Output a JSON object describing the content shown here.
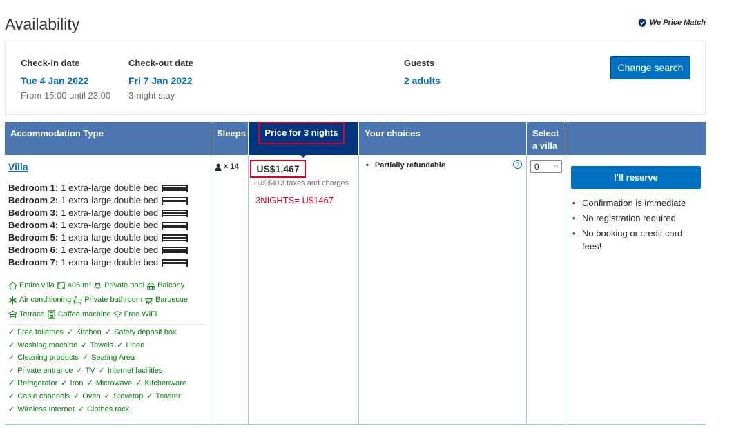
{
  "header": {
    "title": "Availability",
    "price_match": "We Price Match"
  },
  "search": {
    "checkin_label": "Check-in date",
    "checkin_value": "Tue 4 Jan 2022",
    "checkin_sub": "From 15:00 until 23:00",
    "checkout_label": "Check-out date",
    "checkout_value": "Fri 7 Jan 2022",
    "checkout_sub": "3-night stay",
    "guests_label": "Guests",
    "guests_value": "2 adults",
    "change_label": "Change search"
  },
  "table": {
    "headers": {
      "accommodation": "Accommodation Type",
      "sleeps": "Sleeps",
      "price": "Price for 3 nights",
      "choices": "Your choices",
      "select_line1": "Select",
      "select_line2": "a villa"
    },
    "row": {
      "name": "Villa",
      "bedrooms": [
        {
          "label": "Bedroom 1:",
          "bed": "1 extra-large double bed"
        },
        {
          "label": "Bedroom 2:",
          "bed": "1 extra-large double bed"
        },
        {
          "label": "Bedroom 3:",
          "bed": "1 extra-large double bed"
        },
        {
          "label": "Bedroom 4:",
          "bed": "1 extra-large double bed"
        },
        {
          "label": "Bedroom 5:",
          "bed": "1 extra-large double bed"
        },
        {
          "label": "Bedroom 6:",
          "bed": "1 extra-large double bed"
        },
        {
          "label": "Bedroom 7:",
          "bed": "1 extra-large double bed"
        }
      ],
      "facilities": [
        [
          "Entire villa",
          "405 m²",
          "Private pool",
          "Balcony"
        ],
        [
          "Air conditioning",
          "Private bathroom",
          "Barbecue"
        ],
        [
          "Terrace",
          "Coffee machine",
          "Free WiFi"
        ]
      ],
      "amenities": [
        [
          "Free toiletries",
          "Kitchen",
          "Safety deposit box"
        ],
        [
          "Washing machine",
          "Towels",
          "Linen"
        ],
        [
          "Cleaning products",
          "Seating Area"
        ],
        [
          "Private entrance",
          "TV",
          "Internet facilities"
        ],
        [
          "Refrigerator",
          "Iron",
          "Microwave",
          "Kitchenware"
        ],
        [
          "Cable channels",
          "Oven",
          "Stovetop",
          "Toaster"
        ],
        [
          "Wireless Internet",
          "Clothes rack"
        ]
      ],
      "sleeps": "× 14",
      "price": "US$1,467",
      "taxes": "+US$413 taxes and charges",
      "annotation": "3NIGHTS= U$1467",
      "choice": "Partially refundable",
      "select_value": "0",
      "reserve_label": "I'll reserve",
      "reserve_notes": [
        "Confirmation is immediate",
        "No registration required",
        "No booking or credit card fees!"
      ]
    }
  },
  "colors": {
    "accent_blue": "#0071c2",
    "header_blue": "#4b76b2",
    "header_dark": "#003580",
    "green": "#008009",
    "annotation_red": "#e0001a"
  },
  "icons": {
    "price_match": "shield-check-icon",
    "sleeps": "person-icon",
    "bed": "bed-icon",
    "info": "info-icon"
  }
}
